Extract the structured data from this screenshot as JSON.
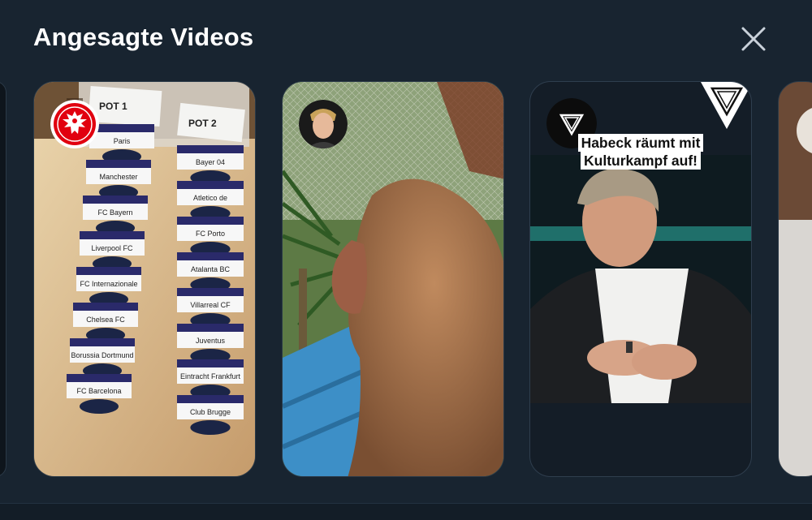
{
  "header": {
    "title": "Angesagte Videos",
    "close_icon": "close-icon"
  },
  "cards": [
    {
      "id": "draw",
      "avatar_icon": "eintracht-frankfurt-eagle-icon",
      "labels": {
        "pot1": "POT 1",
        "pot2": "POT 2",
        "left": [
          "Paris",
          "Manchester",
          "FC Bayern",
          "Liverpool FC",
          "FC Internazionale",
          "Chelsea FC",
          "Borussia Dortmund",
          "FC Barcelona"
        ],
        "right": [
          "Bayer 04",
          "Atletico de",
          "FC Porto",
          "Atalanta BC",
          "Villarreal CF",
          "Juventus",
          "Eintracht Frankfurt",
          "Club Brugge"
        ]
      }
    },
    {
      "id": "monkey",
      "avatar_icon": "profile-photo"
    },
    {
      "id": "habeck",
      "avatar_icon": "triangle-logo-icon",
      "corner_icon": "triangle-logo-icon",
      "overlay_text": "Habeck räumt mit Kulturkampf auf!"
    }
  ],
  "colors": {
    "background": "#182430",
    "accent": "#ffffff",
    "frankfurt_red": "#e1000f"
  }
}
